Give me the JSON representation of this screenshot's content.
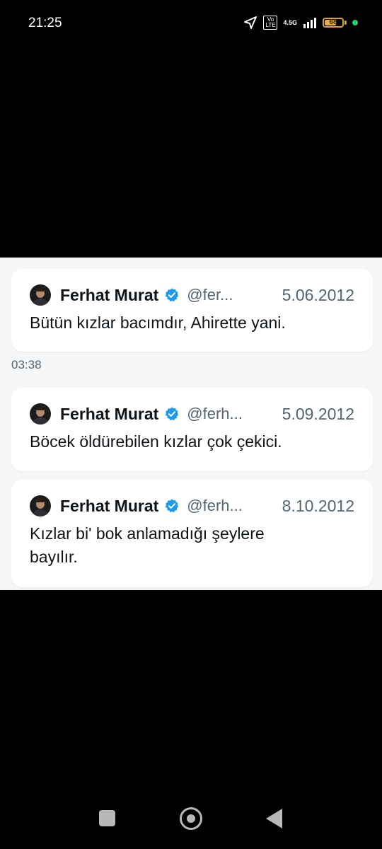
{
  "status_bar": {
    "time": "21:25",
    "volte": "Vo LTE",
    "network": "4.5G",
    "battery": "68",
    "battery_level": 0.68,
    "colors": {
      "battery": "#e4b03b",
      "dot": "#2ecc71"
    }
  },
  "tweets": [
    {
      "name": "Ferhat Murat",
      "handle": "@fer...",
      "date": "5.06.2012",
      "text": "Bütün kızlar bacımdır, Ahirette yani."
    },
    {
      "name": "Ferhat Murat",
      "handle": "@ferh...",
      "date": "5.09.2012",
      "text": "Böcek öldürebilen kızlar çok çekici."
    },
    {
      "name": "Ferhat Murat",
      "handle": "@ferh...",
      "date": "8.10.2012",
      "text": "Kızlar bi' bok anlamadığı şeylere bayılır."
    }
  ],
  "message_time": "03:38",
  "accent_color": "#1d9bf0",
  "nav": {
    "recent": "square-icon",
    "home": "circle-home-icon",
    "back": "triangle-back-icon"
  }
}
